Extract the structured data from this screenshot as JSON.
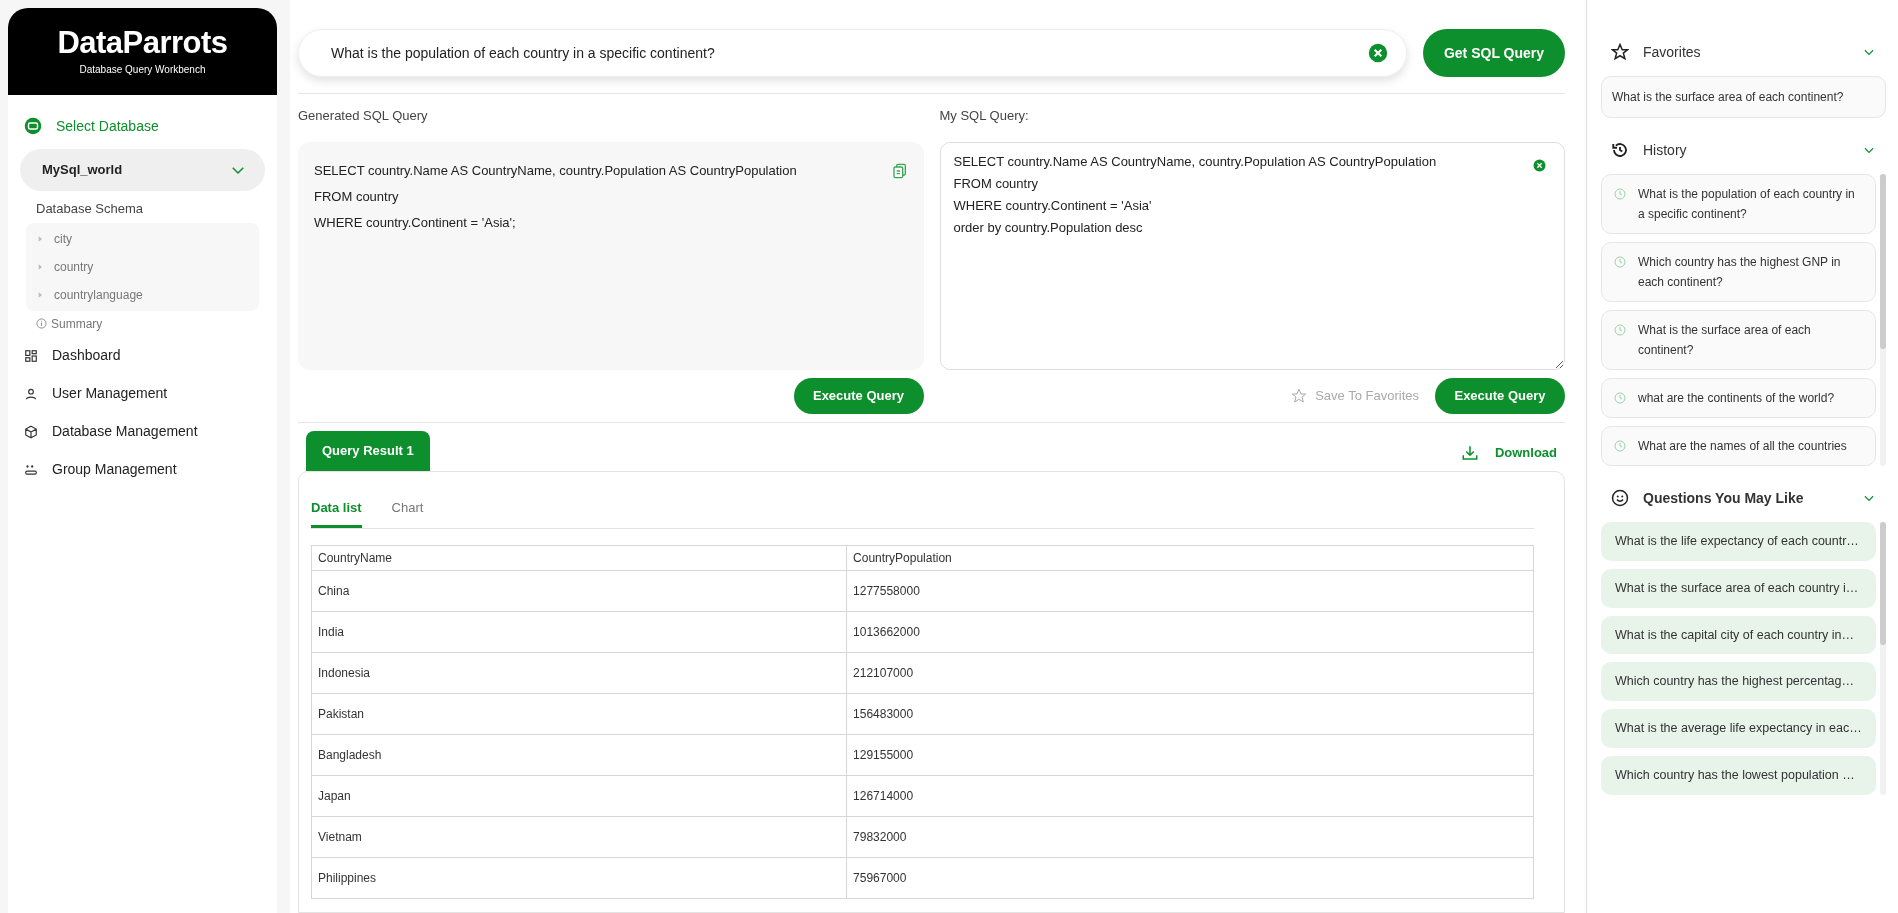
{
  "brand": {
    "name": "DataParrots",
    "subtitle": "Database Query Workbench"
  },
  "sidebar": {
    "database_label": "Select Database",
    "database_selected": true,
    "database_value": "MySql_world",
    "schema_label": "Database Schema",
    "schema_tables": [
      {
        "name": "city",
        "expanded": false
      },
      {
        "name": "country",
        "expanded": false
      },
      {
        "name": "countrylanguage",
        "expanded": false
      }
    ],
    "summary_link": "Summary",
    "nav_items": [
      {
        "label": "Dashboard",
        "selected": false
      },
      {
        "label": "User Management",
        "selected": false
      },
      {
        "label": "Database Management",
        "selected": false
      },
      {
        "label": "Group Management",
        "selected": false
      }
    ]
  },
  "question_bar": {
    "value": "What is the population of each country in a specific continent?",
    "button": "Get SQL Query"
  },
  "generated_query": {
    "label": "Generated SQL Query",
    "lines": [
      "SELECT country.Name AS CountryName, country.Population AS CountryPopulation",
      "FROM country",
      "WHERE country.Continent = 'Asia';"
    ],
    "button": "Execute Query"
  },
  "my_query": {
    "label": "My SQL Query:",
    "lines": [
      "SELECT country.Name AS CountryName, country.Population AS CountryPopulation",
      "FROM country",
      "WHERE country.Continent = 'Asia'",
      "order by country.Population desc"
    ],
    "save_link": "Save To Favorites",
    "button": "Execute Query"
  },
  "results": {
    "tabs": [
      {
        "label": "Query Result 1",
        "selected": true
      }
    ],
    "download": "Download",
    "view_tabs": [
      {
        "label": "Data list",
        "selected": true
      },
      {
        "label": "Chart",
        "selected": false
      }
    ],
    "table": {
      "columns": [
        "CountryName",
        "CountryPopulation"
      ],
      "rows": [
        [
          "China",
          "1277558000"
        ],
        [
          "India",
          "1013662000"
        ],
        [
          "Indonesia",
          "212107000"
        ],
        [
          "Pakistan",
          "156483000"
        ],
        [
          "Bangladesh",
          "129155000"
        ],
        [
          "Japan",
          "126714000"
        ],
        [
          "Vietnam",
          "79832000"
        ],
        [
          "Philippines",
          "75967000"
        ]
      ]
    }
  },
  "right_panel": {
    "favorites": {
      "title": "Favorites",
      "expanded": true,
      "items": [
        "What is the surface area of each continent?"
      ]
    },
    "history": {
      "title": "History",
      "expanded": true,
      "items": [
        "What is the population of each country in a specific continent?",
        "Which country has the highest GNP in each continent?",
        "What is the surface area of each continent?",
        "what are the continents of the world?",
        "What are the names of all the countries"
      ]
    },
    "suggestions": {
      "title": "Questions You May Like",
      "expanded": true,
      "items": [
        "What is the life expectancy of each countr…",
        "What is the surface area of each country i…",
        "What is the capital city of each country in…",
        "Which country has the highest percentag…",
        "What is the average life expectancy in eac…",
        "Which country has the lowest population …"
      ]
    }
  }
}
